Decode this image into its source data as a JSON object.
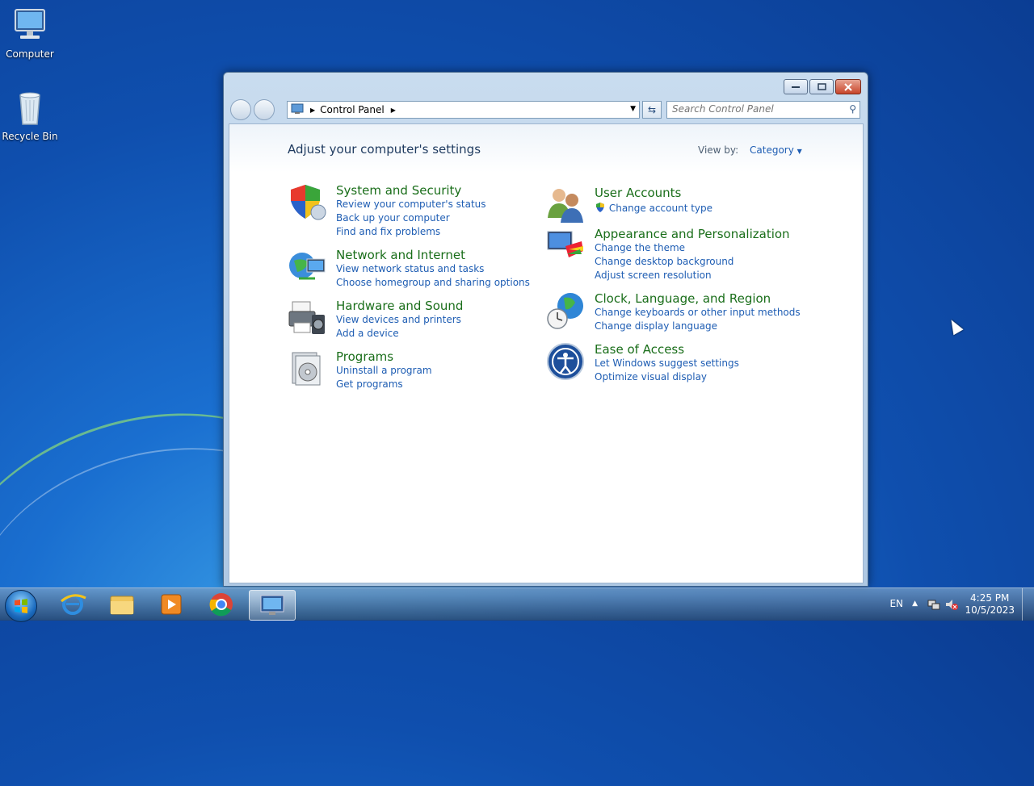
{
  "desktop": {
    "icons": [
      {
        "label": "Computer",
        "icon": "computer-icon"
      },
      {
        "label": "Recycle Bin",
        "icon": "recycle-bin-icon"
      }
    ]
  },
  "window": {
    "title": "Control Panel",
    "breadcrumb": [
      "Control Panel"
    ],
    "search_placeholder": "Search Control Panel",
    "heading": "Adjust your computer's settings",
    "view_by_label": "View by:",
    "view_by_value": "Category",
    "categories": [
      {
        "title": "System and Security",
        "icon": "shield-icon",
        "links": [
          "Review your computer's status",
          "Back up your computer",
          "Find and fix problems"
        ]
      },
      {
        "title": "Network and Internet",
        "icon": "network-globe-icon",
        "links": [
          "View network status and tasks",
          "Choose homegroup and sharing options"
        ]
      },
      {
        "title": "Hardware and Sound",
        "icon": "printer-icon",
        "links": [
          "View devices and printers",
          "Add a device"
        ]
      },
      {
        "title": "Programs",
        "icon": "programs-icon",
        "links": [
          "Uninstall a program",
          "Get programs"
        ]
      },
      {
        "title": "User Accounts",
        "icon": "users-icon",
        "links": [
          "Change account type"
        ]
      },
      {
        "title": "Appearance and Personalization",
        "icon": "monitor-palette-icon",
        "links": [
          "Change the theme",
          "Change desktop background",
          "Adjust screen resolution"
        ]
      },
      {
        "title": "Clock, Language, and Region",
        "icon": "clock-globe-icon",
        "links": [
          "Change keyboards or other input methods",
          "Change display language"
        ]
      },
      {
        "title": "Ease of Access",
        "icon": "ease-of-access-icon",
        "links": [
          "Let Windows suggest settings",
          "Optimize visual display"
        ]
      }
    ]
  },
  "taskbar": {
    "pinned": [
      "internet-explorer-icon",
      "file-explorer-icon",
      "media-player-icon",
      "chrome-icon",
      "control-panel-icon"
    ],
    "language": "EN",
    "time": "4:25 PM",
    "date": "10/5/2023"
  },
  "colors": {
    "category_title": "#1a6e1a",
    "link": "#1e5db3",
    "desktop": "#0f4fae"
  }
}
